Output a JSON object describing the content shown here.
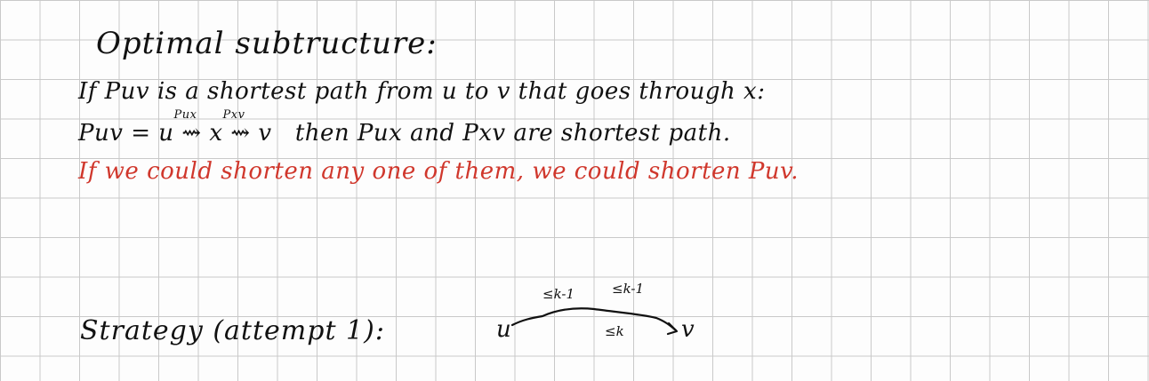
{
  "notes": {
    "heading": "Optimal subtructure:",
    "line2": "If Puv is a shortest path from u to v that goes through x:",
    "line3": {
      "lhs": "Puv = u",
      "p_ux": "Pux",
      "x": "x",
      "p_xv": "Pxv",
      "v": "v",
      "rest": "then Pux and Pxv are shortest path."
    },
    "line4": "If we could shorten any one of them, we could shorten Puv.",
    "line5": "Strategy (attempt 1):"
  },
  "diagram": {
    "start": "u",
    "end": "v",
    "label_left": "≤k-1",
    "label_right": "≤k-1",
    "label_bottom": "≤k"
  },
  "colors": {
    "ink": "#111111",
    "red_ink": "#d0372c",
    "grid": "#c9c9c9"
  }
}
